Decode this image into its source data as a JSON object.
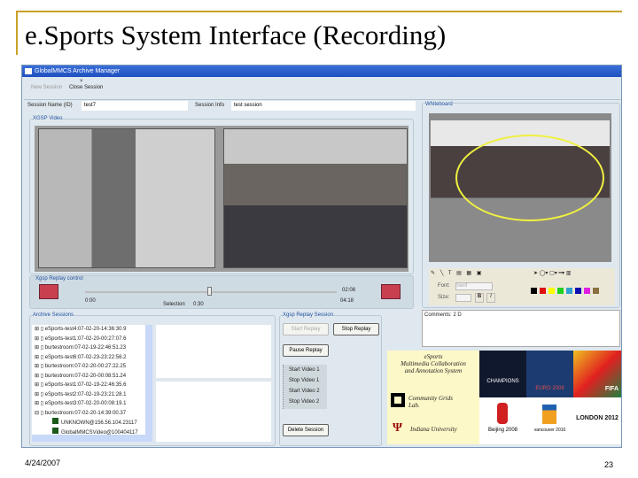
{
  "slide": {
    "title": "e.Sports System Interface (Recording)",
    "date": "4/24/2007",
    "page": "23"
  },
  "app": {
    "window_title": "GlobalMMCS Archive Manager",
    "toolbar": {
      "new_session": "New Session",
      "close_session": "Close Session"
    },
    "session_name_label": "Session Name (ID)",
    "session_name_value": "test7",
    "session_info_label": "Session Info",
    "session_info_value": "test session",
    "xgsp_video_label": "XGSP Video",
    "whiteboard_label": "Whiteboard",
    "replay_control": {
      "label": "Xgsp Replay control",
      "start": "0:00",
      "end": "04:18",
      "right_time": "02:08",
      "selection_label": "Selection",
      "selection_value": "0:30",
      "position_fraction": 0.12
    },
    "archive_sessions": {
      "label": "Archive Sessions",
      "items": [
        "eSports-test4:07-02-20-14:36:30.9",
        "eSports-test1:07-02-20-00:27:07.6",
        "burtestroom:07-02-19-22:46:51.23",
        "eSports-test6:07-02-23-23:22:56.2",
        "burtestroom:07-02-20-00:27:22.25",
        "burtestroom:07-02-20-00:08:51.24",
        "eSports-test1:07-02-19-22:46:35.6",
        "eSports-test2:07-02-19-23:21:28.1",
        "eSports-test3:07-02-20-00:08:19.1",
        "burtestroom:07-02-20-14:39:00.37"
      ],
      "children": [
        "UNKNOWN@156.56.104.23117",
        "GlobalMMCSVideo@100404117"
      ]
    },
    "replay_session": {
      "label": "Xgsp Replay Session",
      "start_replay": "Start Replay",
      "stop_replay": "Stop Replay",
      "pause_replay": "Pause Replay",
      "video_controls": [
        "Start Video 1",
        "Stop Video 1",
        "Start Video 2",
        "Stop Video 2"
      ],
      "delete_session": "Delete Session"
    },
    "whiteboard_tools": {
      "font_label": "Font:",
      "font_value": "Serif",
      "size_label": "Size:",
      "bold": "B",
      "italic": "I",
      "colors": [
        "#000000",
        "#e01010",
        "#ffff00",
        "#20d020",
        "#30a0d0",
        "#1010b0",
        "#e020e0",
        "#8a7040"
      ]
    },
    "comments": "Comments: 2 D"
  },
  "logos": {
    "esports": [
      "eSports",
      "Multimedia Collaboration",
      "and Annotation System"
    ],
    "cgl": "Community Grids Lab.",
    "iu": "Indiana University",
    "champions": "CHAMPIONS",
    "euro": "EURO 2008",
    "fifa": "FIFA",
    "beijing": "Beijing 2008",
    "vancouver": "vancouver 2010",
    "london": "LONDON 2012"
  }
}
